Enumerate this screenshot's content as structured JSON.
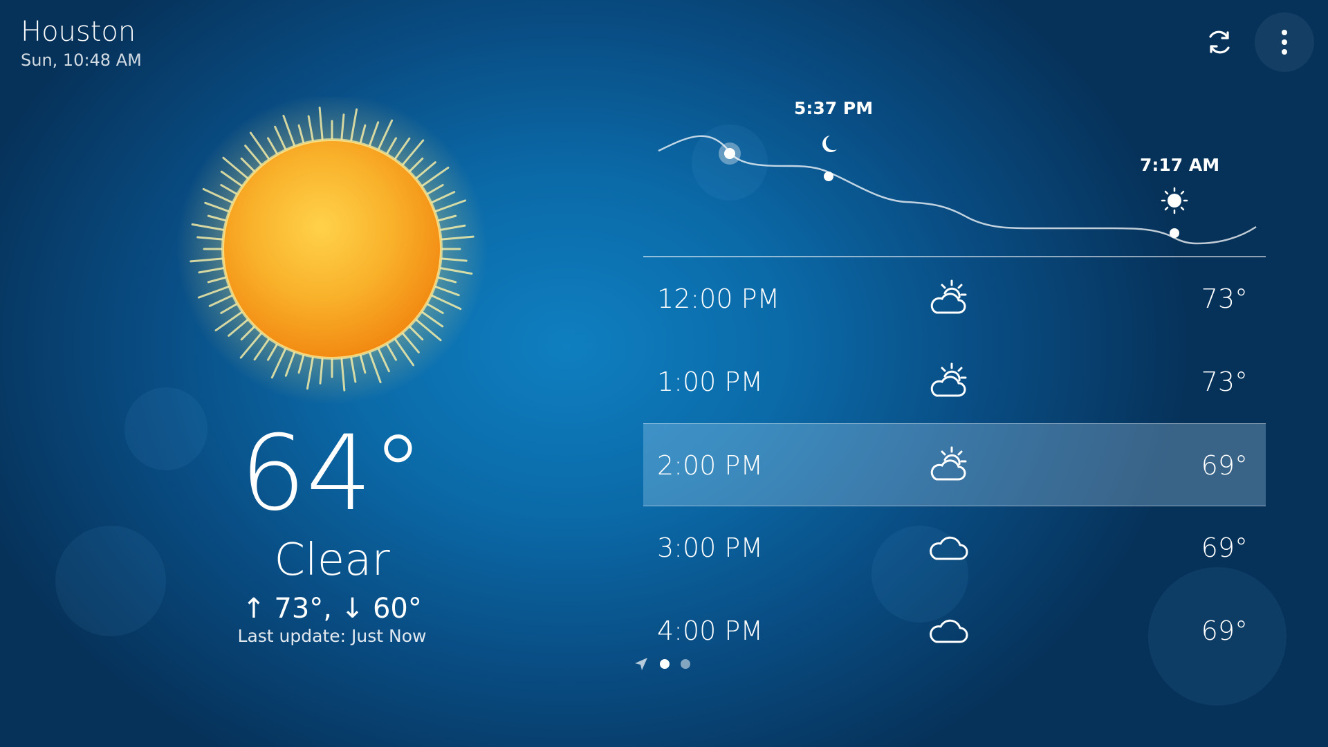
{
  "header": {
    "city": "Houston",
    "datetime": "Sun, 10:48 AM",
    "icons": {
      "refresh": "refresh-icon",
      "menu": "more-vertical-icon"
    }
  },
  "current": {
    "temperature": "64°",
    "condition": "Clear",
    "high_low": "↑ 73°, ↓ 60°",
    "last_update": "Last update: Just Now",
    "icon": "sun-icon"
  },
  "sun_timeline": {
    "sunset": {
      "time": "5:37 PM",
      "icon": "moon-icon"
    },
    "sunrise": {
      "time": "7:17 AM",
      "icon": "sun-small-icon"
    }
  },
  "hourly": [
    {
      "time": "12:00 PM",
      "icon": "partly-sunny-icon",
      "temp": "73°",
      "selected": false
    },
    {
      "time": "1:00 PM",
      "icon": "partly-sunny-icon",
      "temp": "73°",
      "selected": false
    },
    {
      "time": "2:00 PM",
      "icon": "partly-sunny-icon",
      "temp": "69°",
      "selected": true
    },
    {
      "time": "3:00 PM",
      "icon": "cloud-icon",
      "temp": "69°",
      "selected": false
    },
    {
      "time": "4:00 PM",
      "icon": "cloud-icon",
      "temp": "69°",
      "selected": false
    }
  ],
  "pager": {
    "icon": "location-arrow-icon",
    "pages": 2,
    "active": 0
  },
  "colors": {
    "background": "#0b6aa8",
    "sun_core": "#f7a21b",
    "sun_glow": "#fff3a0",
    "selected_row": "#6ea9cf"
  }
}
